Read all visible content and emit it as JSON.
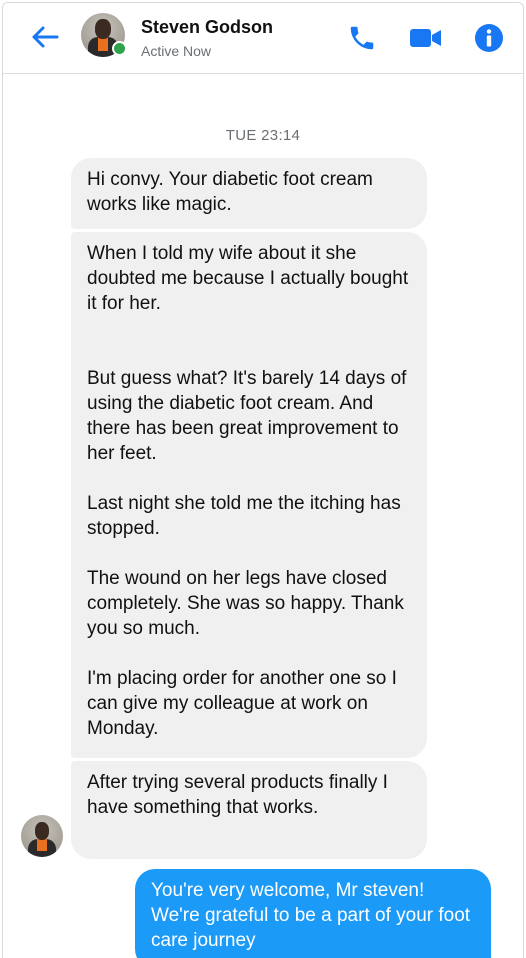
{
  "header": {
    "contact_name": "Steven Godson",
    "status": "Active Now",
    "back_icon": "arrow-left-icon",
    "call_icon": "phone-icon",
    "video_icon": "video-camera-icon",
    "info_icon": "info-icon",
    "accent_color": "#1877f2"
  },
  "conversation": {
    "timestamp": "TUE 23:14",
    "incoming": [
      {
        "paragraphs": [
          "Hi convy. Your diabetic foot cream works like magic."
        ]
      },
      {
        "paragraphs": [
          "When I told my wife about it she doubted me because I actually bought it for her.",
          "But guess what? It's barely 14 days of using the diabetic foot cream. And there has been great improvement to her feet.",
          "Last night she told me the itching has stopped.",
          "The wound on her legs have closed completely.  She was so happy. Thank you so much.",
          "I'm placing order for another one so I can give my colleague at work on Monday."
        ]
      },
      {
        "paragraphs": [
          "After trying several products finally I have something that works."
        ]
      }
    ],
    "outgoing": [
      {
        "text": "You're very welcome, Mr steven! We're grateful to be a part of your foot care journey"
      }
    ],
    "incoming_bubble_color": "#f0f0f0",
    "outgoing_bubble_color": "#1b9af7"
  }
}
